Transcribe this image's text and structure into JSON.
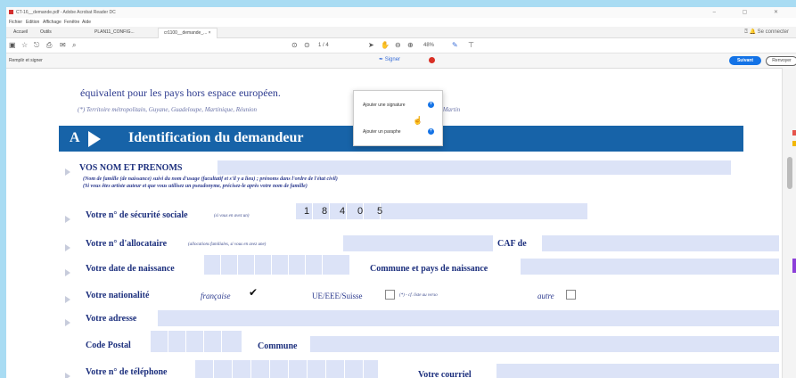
{
  "window": {
    "title": "CT-16__demande.pdf - Adobe Acrobat Reader DC",
    "controls": "–  ▢  ✕"
  },
  "menu": [
    "Fichier",
    "Edition",
    "Affichage",
    "Fenêtre",
    "Aide"
  ],
  "tabs": {
    "home": "Accueil",
    "tools": "Outils",
    "tab1": "PLAN11_CONFIG...",
    "tab2": "cr1100__demande_...  ×",
    "right": "⍰  🔔   Se connecter"
  },
  "toolbar": {
    "page": "1 / 4",
    "zoom": "48%"
  },
  "signbar": {
    "label": "Remplir et signer",
    "sign_tool": "Signer",
    "send_button": "Suivant",
    "next_button": "Renvoyer"
  },
  "popup": {
    "add_signature": "Ajouter une signature",
    "add_initials": "Ajouter un paraphe"
  },
  "document": {
    "intro": "équivalent pour les pays hors espace européen.",
    "note": "(*) Territoire métropolitain, Guyane, Guadeloupe, Martinique, Réunion",
    "note_end": "Saint-Martin",
    "section_letter": "A",
    "section_title": "Identification du demandeur",
    "name_label": "VOS NOM ET PRENOMS",
    "name_help1": "(Nom de famille (de naissance) suivi du nom d'usage (facultatif et s'il y a lieu) ; prénoms dans l'ordre de l'état civil)",
    "name_help2": "(Si vous êtes artiste auteur et que vous utilisez un pseudonyme, précisez-le après votre nom de famille)",
    "ss_label": "Votre n° de sécurité sociale",
    "ss_hint": "(si vous en avez un)",
    "ss_digits": [
      "1",
      "8",
      "4",
      "0",
      "5"
    ],
    "alloc_label": "Votre n° d'allocataire",
    "alloc_hint": "(allocations familiales, si vous en avez une)",
    "caf_label": "CAF de",
    "birth_label": "Votre date de naissance",
    "commune_birth_label": "Commune et pays de naissance",
    "nationality_label": "Votre nationalité",
    "nat_fr": "française",
    "nat_eu": "UE/EEE/Suisse",
    "nat_eu_hint": "(*) - cf. liste au verso",
    "nat_other": "autre",
    "address_label": "Votre adresse",
    "postal_label": "Code Postal",
    "commune_label": "Commune",
    "phone_label": "Votre n° de téléphone",
    "email_label": "Votre courriel"
  },
  "colors": {
    "section_blue": "#1763a8",
    "field_blue": "#dce3f7",
    "primary_button": "#1473e6"
  }
}
